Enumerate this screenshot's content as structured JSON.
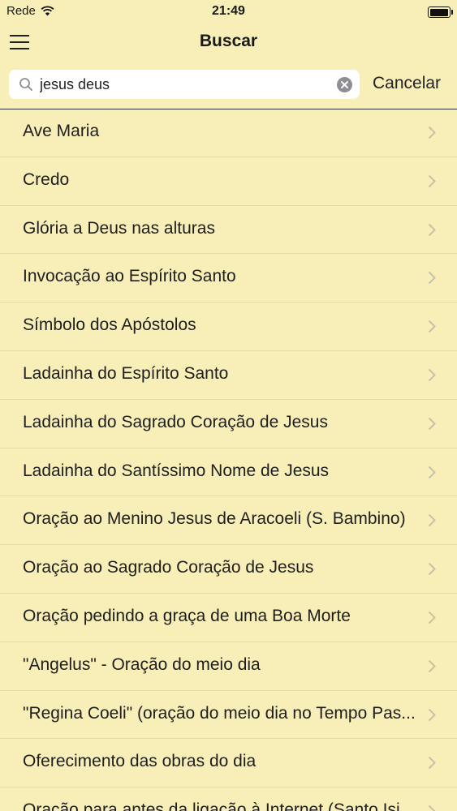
{
  "status_bar": {
    "carrier": "Rede",
    "time": "21:49"
  },
  "nav": {
    "title": "Buscar"
  },
  "search": {
    "value": "jesus deus",
    "placeholder": "",
    "cancel_label": "Cancelar"
  },
  "results": [
    {
      "label": "Ave Maria"
    },
    {
      "label": "Credo"
    },
    {
      "label": "Glória a Deus nas alturas"
    },
    {
      "label": "Invocação ao Espírito Santo"
    },
    {
      "label": "Símbolo dos Apóstolos"
    },
    {
      "label": "Ladainha do Espírito Santo"
    },
    {
      "label": "Ladainha do Sagrado Coração de Jesus"
    },
    {
      "label": "Ladainha do Santíssimo Nome de Jesus"
    },
    {
      "label": "Oração ao Menino Jesus de Aracoeli (S. Bambino)"
    },
    {
      "label": "Oração ao Sagrado Coração de Jesus"
    },
    {
      "label": "Oração pedindo a graça de uma Boa Morte"
    },
    {
      "label": "\"Angelus\" - Oração do meio dia"
    },
    {
      "label": "\"Regina Coeli\" (oração do meio dia no Tempo Pas..."
    },
    {
      "label": "Oferecimento das obras do dia"
    },
    {
      "label": "Oração para antes da ligação à Internet (Santo Isi..."
    }
  ],
  "colors": {
    "background": "#f8eeb8",
    "divider": "#e6d9a0",
    "chevron": "#c7c2a8"
  }
}
